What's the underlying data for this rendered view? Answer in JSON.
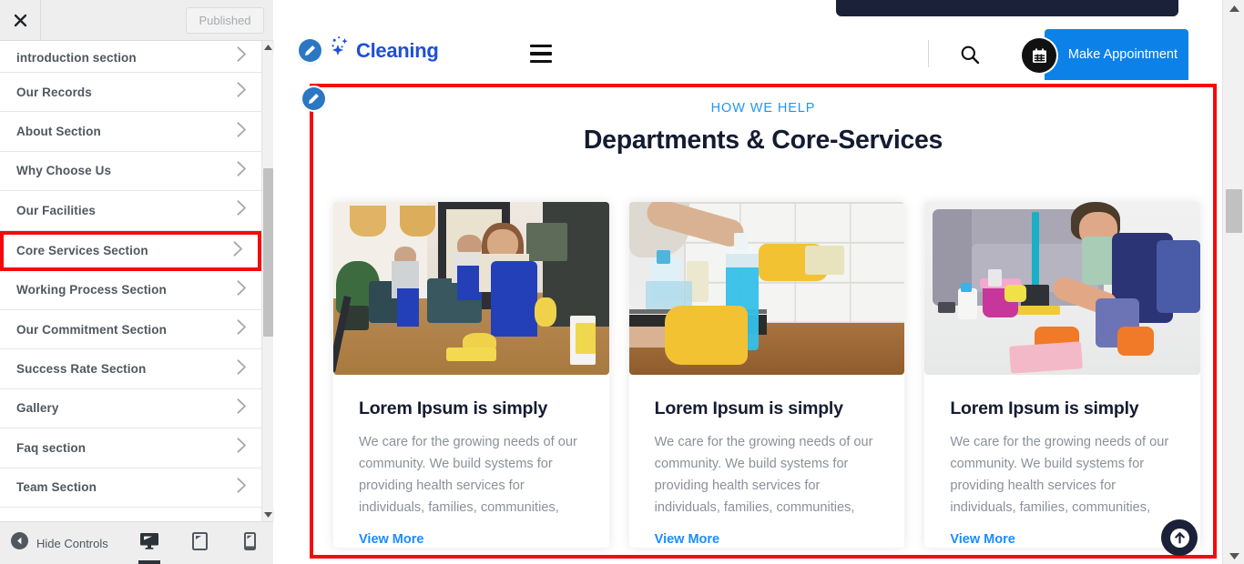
{
  "customizer": {
    "close_icon": "close-icon",
    "publish_label": "Published",
    "sections": [
      {
        "label": "introduction section",
        "partial": true,
        "highlighted": false
      },
      {
        "label": "Our Records",
        "highlighted": false
      },
      {
        "label": "About Section",
        "highlighted": false
      },
      {
        "label": "Why Choose Us",
        "highlighted": false
      },
      {
        "label": "Our Facilities",
        "highlighted": false
      },
      {
        "label": "Core Services Section",
        "highlighted": true
      },
      {
        "label": "Working Process Section",
        "highlighted": false
      },
      {
        "label": "Our Commitment Section",
        "highlighted": false
      },
      {
        "label": "Success Rate Section",
        "highlighted": false
      },
      {
        "label": "Gallery",
        "highlighted": false
      },
      {
        "label": "Faq section",
        "highlighted": false
      },
      {
        "label": "Team Section",
        "highlighted": false
      }
    ],
    "footer": {
      "hide_controls_label": "Hide Controls",
      "devices": [
        {
          "name": "desktop-view-button",
          "active": true
        },
        {
          "name": "tablet-view-button",
          "active": false
        },
        {
          "name": "mobile-view-button",
          "active": false
        }
      ]
    }
  },
  "preview": {
    "header": {
      "brand_name": "Cleaning",
      "menu_icon": "hamburger-menu-icon",
      "search_icon": "search-icon",
      "calendar_icon": "calendar-icon",
      "appointment_label": "Make Appointment",
      "accent_blue": "#0c82e8",
      "navy": "#1b2138"
    },
    "section": {
      "eyebrow": "HOW WE HELP",
      "title": "Departments & Core-Services",
      "highlight_color": "#f50a0a",
      "cards": [
        {
          "image": "cleaning-team-in-office-photo",
          "title": "Lorem Ipsum is simply",
          "desc": "We care for the growing needs of our community. We build systems for providing health services for individuals, families, communities,",
          "link": "View More"
        },
        {
          "image": "hand-wiping-kitchen-tiles-photo",
          "title": "Lorem Ipsum is simply",
          "desc": "We care for the growing needs of our community. We build systems for providing health services for individuals, families, communities,",
          "link": "View More"
        },
        {
          "image": "man-cleaning-floor-in-living-room-photo",
          "title": "Lorem Ipsum is simply",
          "desc": "We care for the growing needs of our community. We build systems for providing health services for individuals, families, communities,",
          "link": "View More"
        }
      ]
    },
    "back_to_top_icon": "arrow-up-icon"
  }
}
